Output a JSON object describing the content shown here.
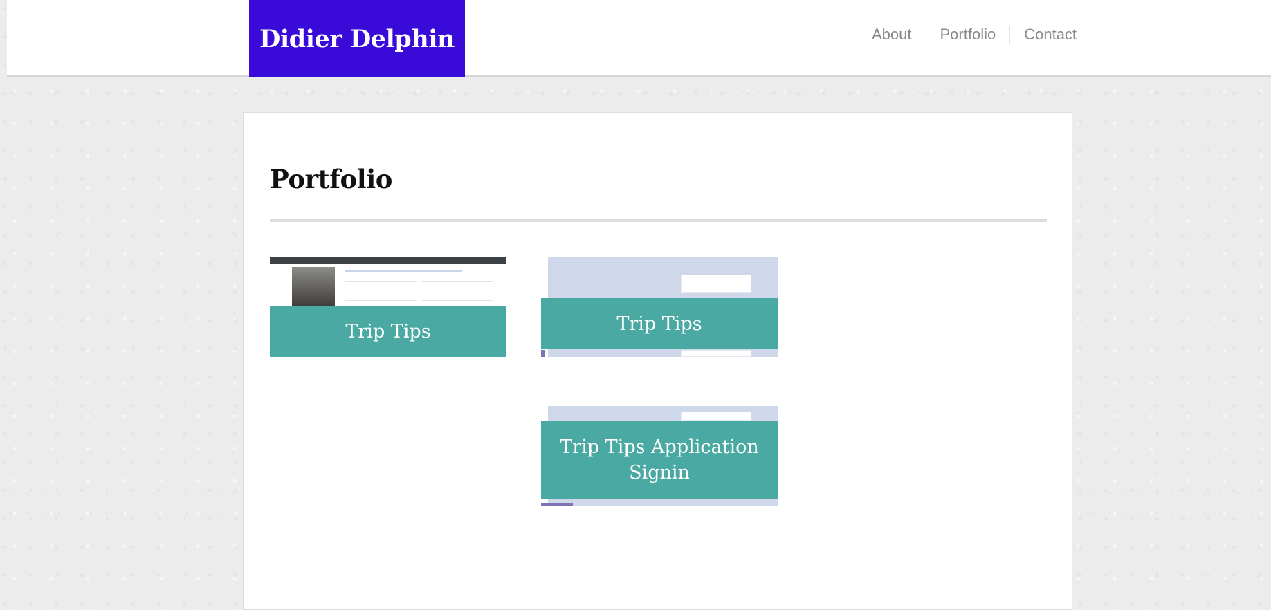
{
  "header": {
    "brand": "Didier Delphin",
    "nav": [
      {
        "label": "About"
      },
      {
        "label": "Portfolio"
      },
      {
        "label": "Contact"
      }
    ]
  },
  "main": {
    "title": "Portfolio",
    "projects": [
      {
        "label": "Trip Tips"
      },
      {
        "label": "Trip Tips"
      },
      {
        "label": "Trip Tips Application Signin"
      }
    ]
  },
  "colors": {
    "brand": "#3a0ad9",
    "card_label": "#4aa9a2",
    "nav_text": "#8a8a8a"
  }
}
